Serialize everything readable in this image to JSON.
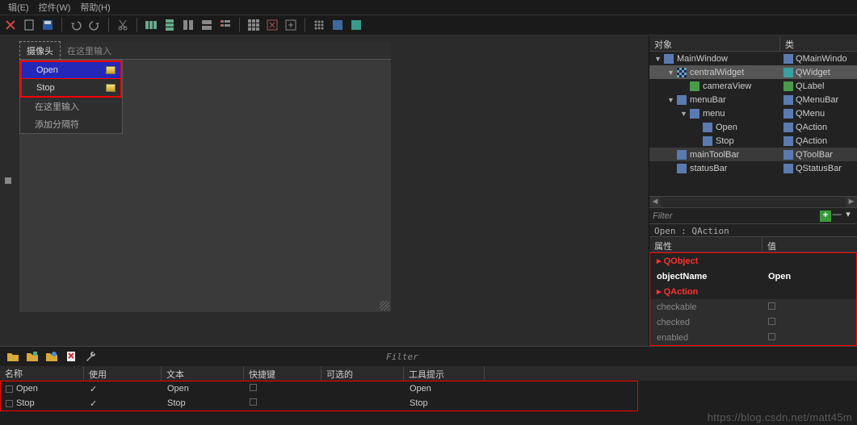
{
  "topmenu": {
    "items": [
      "辑(E)",
      "控件(W)",
      "帮助(H)"
    ]
  },
  "toolbar": {
    "icons": [
      "close-x",
      "square",
      "save",
      "sep",
      "undo",
      "redo",
      "sep",
      "cut",
      "sep",
      "grid3",
      "grid2",
      "bars-h",
      "bars-v",
      "sep",
      "grid9",
      "grid-s",
      "bars",
      "sep",
      "dots",
      "sq-blue",
      "sq-teal"
    ]
  },
  "preview": {
    "menubar_item": "摄像头",
    "menubar_ghost": "在这里输入",
    "dropdown": {
      "items": [
        "Open",
        "Stop"
      ],
      "ghost1": "在这里输入",
      "ghost2": "添加分隔符"
    }
  },
  "object_panel": {
    "header": {
      "col1": "对象",
      "col2": "类"
    },
    "rows": [
      {
        "indent": 0,
        "exp": "▼",
        "name": "MainWindow",
        "cls": "QMainWindo",
        "sel": false
      },
      {
        "indent": 1,
        "exp": "▼",
        "name": "centralWidget",
        "cls": "QWidget",
        "sel": true,
        "grid": true
      },
      {
        "indent": 2,
        "exp": "",
        "name": "cameraView",
        "cls": "QLabel",
        "sel": false,
        "green": true
      },
      {
        "indent": 1,
        "exp": "▼",
        "name": "menuBar",
        "cls": "QMenuBar",
        "sel": false
      },
      {
        "indent": 2,
        "exp": "▼",
        "name": "menu",
        "cls": "QMenu",
        "sel": false
      },
      {
        "indent": 3,
        "exp": "",
        "name": "Open",
        "cls": "QAction",
        "sel": false
      },
      {
        "indent": 3,
        "exp": "",
        "name": "Stop",
        "cls": "QAction",
        "sel": false
      },
      {
        "indent": 1,
        "exp": "",
        "name": "mainToolBar",
        "cls": "QToolBar",
        "sel": "half"
      },
      {
        "indent": 1,
        "exp": "",
        "name": "statusBar",
        "cls": "QStatusBar",
        "sel": false
      }
    ],
    "filter_label": "Filter",
    "selection_text": "Open : QAction"
  },
  "props": {
    "header": {
      "c1": "属性",
      "c2": "值"
    },
    "rows": [
      {
        "kind": "cat",
        "name": "QObject"
      },
      {
        "kind": "on",
        "name": "objectName",
        "value": "Open"
      },
      {
        "kind": "cat",
        "name": "QAction"
      },
      {
        "kind": "dim",
        "name": "checkable",
        "value": ""
      },
      {
        "kind": "dim",
        "name": "checked",
        "value": ""
      },
      {
        "kind": "dim",
        "name": "enabled",
        "value": ""
      }
    ]
  },
  "actions": {
    "filter_label": "Filter",
    "header": [
      "名称",
      "使用",
      "文本",
      "快捷键",
      "可选的",
      "工具提示"
    ],
    "rows": [
      {
        "name": "Open",
        "used": true,
        "text": "Open",
        "shortcut": "",
        "checkable": false,
        "tooltip": "Open"
      },
      {
        "name": "Stop",
        "used": true,
        "text": "Stop",
        "shortcut": "",
        "checkable": false,
        "tooltip": "Stop"
      }
    ]
  },
  "watermark": "https://blog.csdn.net/matt45m"
}
